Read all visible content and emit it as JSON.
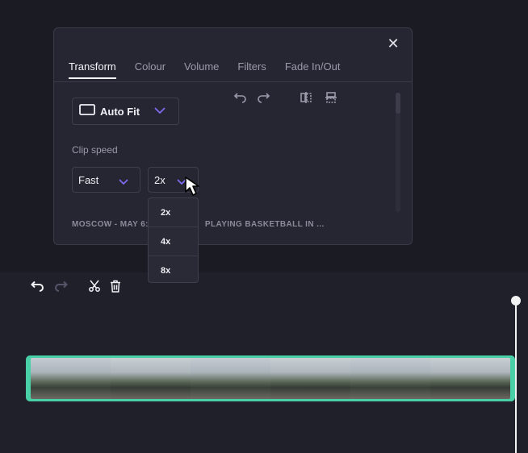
{
  "panel": {
    "close_glyph": "✕",
    "tabs": [
      {
        "label": "Transform",
        "active": true
      },
      {
        "label": "Colour"
      },
      {
        "label": "Volume"
      },
      {
        "label": "Filters"
      },
      {
        "label": "Fade In/Out"
      }
    ],
    "toolbar_icons": [
      "undo-icon",
      "redo-icon",
      "flip-horizontal-icon",
      "flip-vertical-icon"
    ],
    "fit_dropdown": {
      "value": "Auto Fit",
      "icon": "aspect-ratio-icon"
    },
    "clip_speed": {
      "label": "Clip speed",
      "mode_value": "Fast",
      "multiplier_value": "2x",
      "options": [
        "2x",
        "4x",
        "8x"
      ]
    },
    "caption": "MOSCOW - MAY 6:",
    "caption_tail": "PLAYING BASKETBALL IN ..."
  },
  "timeline": {
    "toolbar_icons": [
      "undo-icon",
      "redo-icon",
      "split-icon",
      "delete-icon"
    ]
  },
  "colors": {
    "accent": "#7b6cf0",
    "clip_border": "#4ad0a6",
    "panel_bg": "#262633",
    "page_bg": "#1b1b24"
  }
}
